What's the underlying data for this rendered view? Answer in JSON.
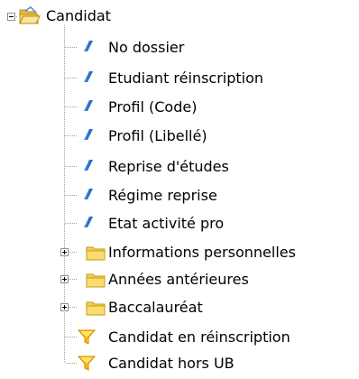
{
  "tree": {
    "root": {
      "label": "Candidat",
      "icon": "folder-open-icon",
      "expanded": true
    },
    "fields": [
      {
        "label": "No dossier",
        "icon": "field-icon"
      },
      {
        "label": "Etudiant réinscription",
        "icon": "field-icon"
      },
      {
        "label": "Profil (Code)",
        "icon": "field-icon"
      },
      {
        "label": "Profil (Libellé)",
        "icon": "field-icon"
      },
      {
        "label": "Reprise d'études",
        "icon": "field-icon"
      },
      {
        "label": "Régime reprise",
        "icon": "field-icon"
      },
      {
        "label": "Etat activité pro",
        "icon": "field-icon"
      }
    ],
    "folders": [
      {
        "label": "Informations personnelles",
        "icon": "folder-icon",
        "expanded": false
      },
      {
        "label": "Années antérieures",
        "icon": "folder-icon",
        "expanded": false
      },
      {
        "label": "Baccalauréat",
        "icon": "folder-icon",
        "expanded": false
      }
    ],
    "filters": [
      {
        "label": "Candidat en réinscription",
        "icon": "filter-icon"
      },
      {
        "label": "Candidat hors UB",
        "icon": "filter-icon"
      }
    ]
  },
  "colors": {
    "field_icon": "#4a8fe7",
    "folder": "#f6cf4a",
    "filter": "#f4c20d",
    "tree_line": "#a0a0a0"
  }
}
